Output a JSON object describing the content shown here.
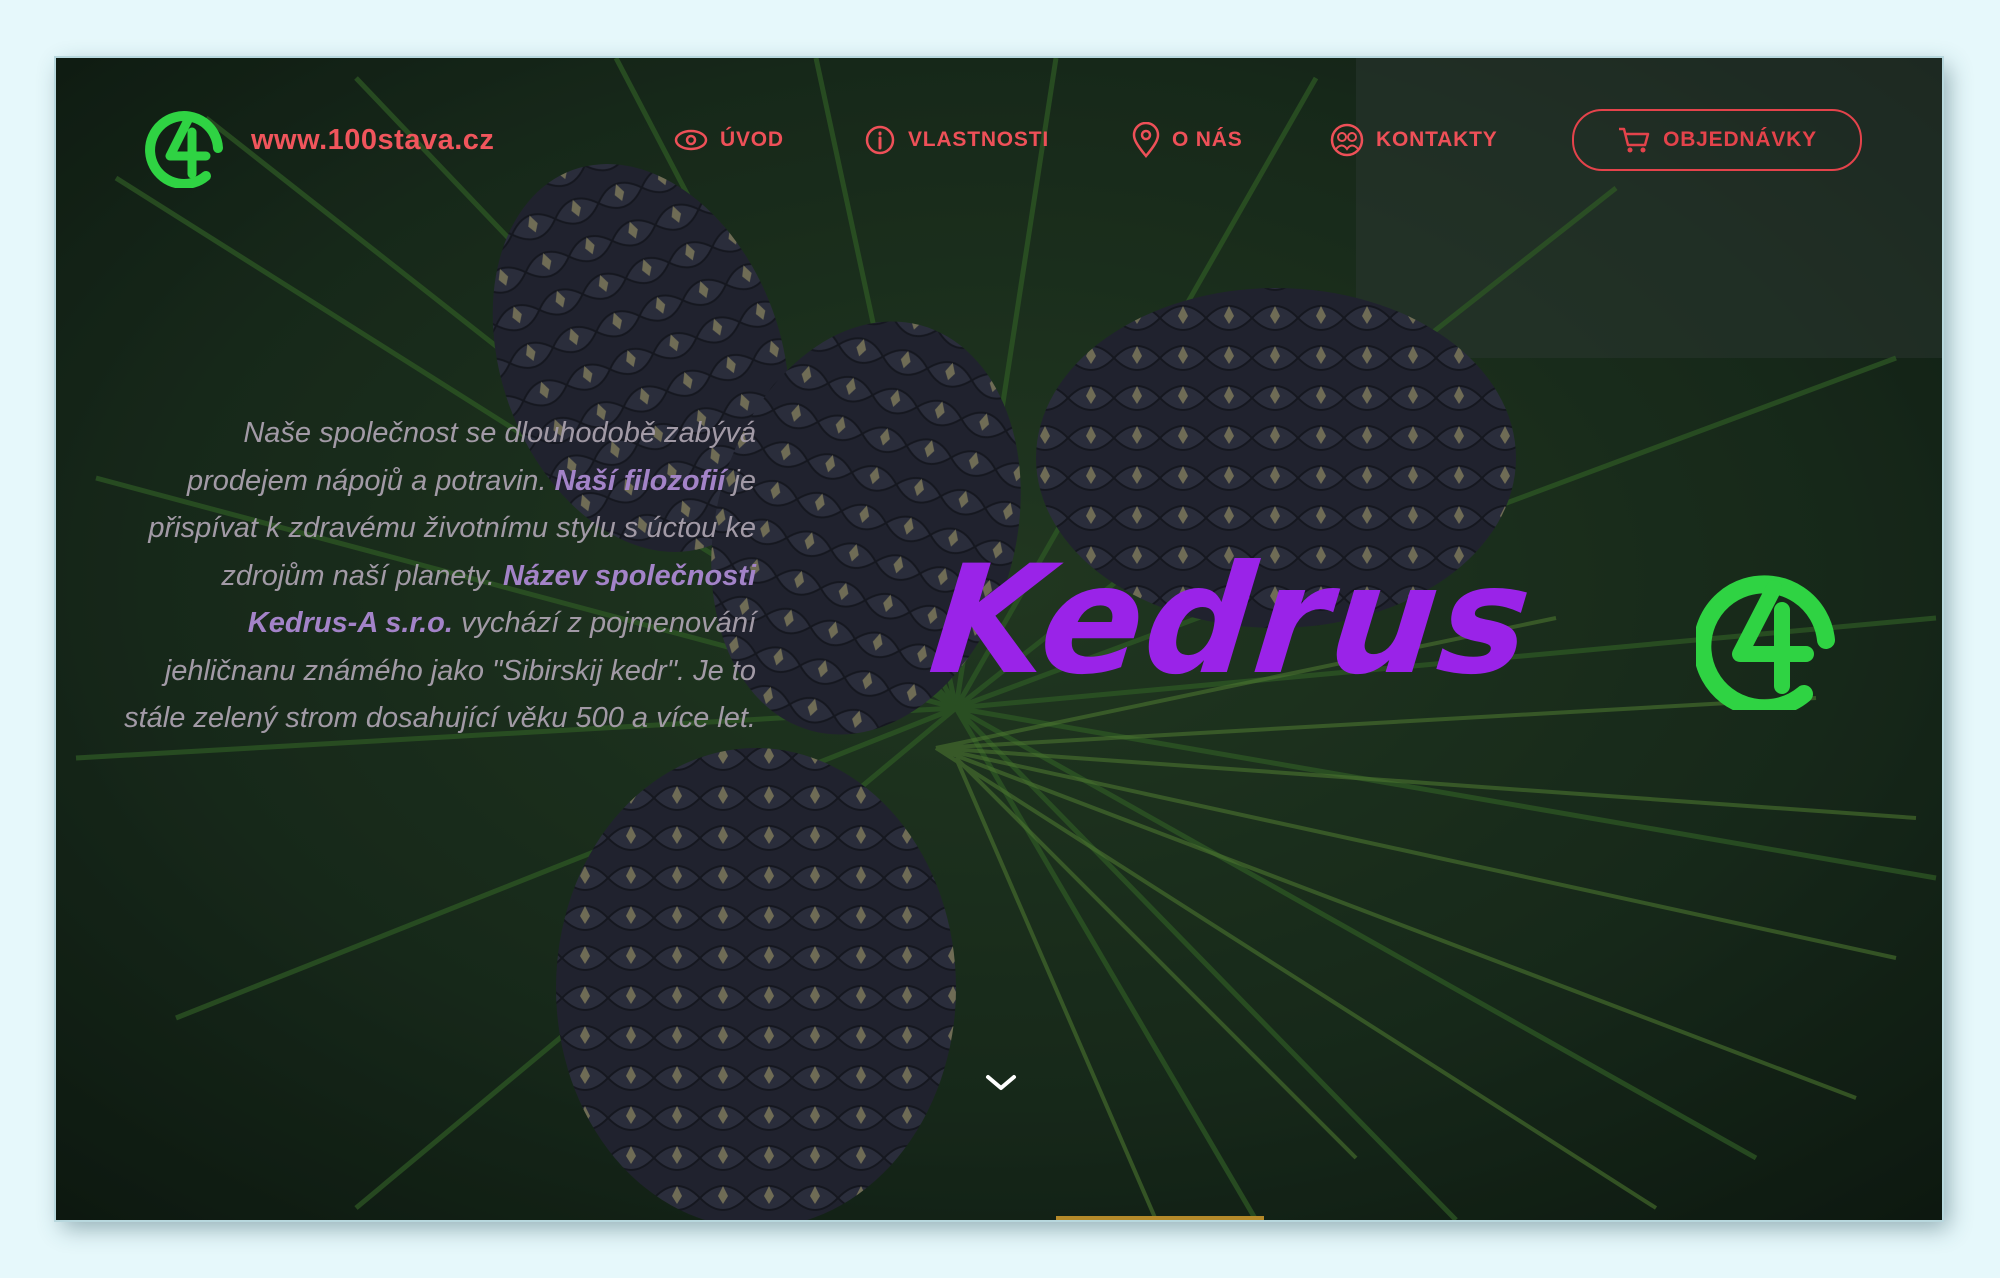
{
  "header": {
    "site_url": "www.100stava.cz",
    "nav": {
      "uvod": "ÚVOD",
      "vlastnosti": "VLASTNOSTI",
      "o_nas": "O NÁS",
      "kontakty": "KONTAKTY"
    },
    "order_label": "OBJEDNÁVKY"
  },
  "about": {
    "p1": "Naše společnost se dlouhodobě zabývá prodejem nápojů a potravin.",
    "p2_bold": "Naší filozofií",
    "p3": "je přispívat k zdravému životnímu stylu s úctou ke zdrojům naší planety.",
    "p4_bold": "Název společnosti Kedrus-A s.r.o.",
    "p5": "vychází z pojmenování jehličnanu známého jako \"Sibirskij kedr\". Je to stále zelený strom dosahující věku 500 a více let."
  },
  "brand": {
    "name": "Kedrus"
  },
  "icons": {
    "logo": "a-circle-logo-icon",
    "uvod": "eye-icon",
    "vlastnosti": "info-icon",
    "o_nas": "location-pin-icon",
    "kontakty": "people-icon",
    "order": "cart-icon",
    "scroll": "chevron-down-icon"
  },
  "colors": {
    "accent_red": "#ee5058",
    "brand_purple": "#9a23e8",
    "logo_green": "#2fd343",
    "text_muted": "#a29aa6"
  }
}
